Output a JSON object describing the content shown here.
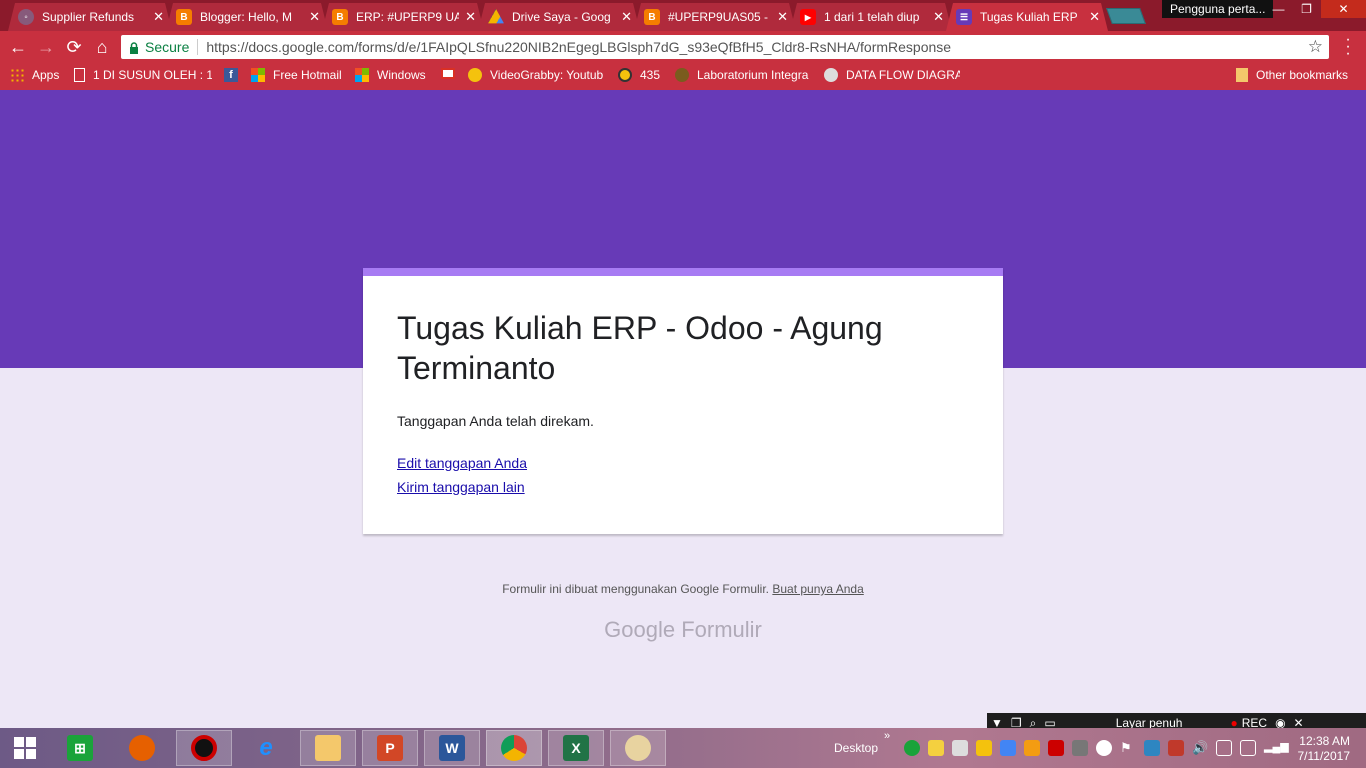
{
  "browser": {
    "tabs": [
      {
        "label": "Supplier Refunds",
        "icon": "odoo-icon",
        "color": "#875a7b"
      },
      {
        "label": "Blogger: Hello, M",
        "icon": "blogger-icon",
        "color": "#f57d00"
      },
      {
        "label": "ERP: #UPERP9 UA",
        "icon": "blogger-icon",
        "color": "#f57d00"
      },
      {
        "label": "Drive Saya - Goog",
        "icon": "drive-icon",
        "color": "#0f9d58"
      },
      {
        "label": "#UPERP9UAS05 -",
        "icon": "blogger-icon",
        "color": "#f57d00"
      },
      {
        "label": "1 dari 1 telah diup",
        "icon": "youtube-icon",
        "color": "#ff0000"
      },
      {
        "label": "Tugas Kuliah ERP",
        "icon": "forms-icon",
        "color": "#673ab7"
      }
    ],
    "profile_label": "Pengguna perta...",
    "address": {
      "secure_label": "Secure",
      "url": "https://docs.google.com/forms/d/e/1FAIpQLSfnu220NIB2nEgegLBGlsph7dG_s93eQfBfH5_Cldr8-RsNHA/formResponse"
    },
    "bookmarks": [
      {
        "label": "Apps",
        "icon": "apps-icon"
      },
      {
        "label": "1 DI SUSUN OLEH : 1",
        "icon": "page-icon"
      },
      {
        "label": "",
        "icon": "facebook-icon"
      },
      {
        "label": "Free Hotmail",
        "icon": "windows-logo-icon"
      },
      {
        "label": "Windows",
        "icon": "windows-logo-icon"
      },
      {
        "label": "",
        "icon": "gmail-icon"
      },
      {
        "label": "VideoGrabby: Youtub",
        "icon": "videograbby-icon"
      },
      {
        "label": "435",
        "icon": "seal-icon"
      },
      {
        "label": "Laboratorium Integra",
        "icon": "seal-icon"
      },
      {
        "label": "DATA FLOW DIAGRA",
        "icon": "diagram-icon"
      }
    ],
    "other_bookmarks": "Other bookmarks"
  },
  "form": {
    "title": "Tugas Kuliah ERP - Odoo - Agung Terminanto",
    "message": "Tanggapan Anda telah direkam.",
    "edit_link": "Edit tanggapan Anda",
    "another_link": "Kirim tanggapan lain",
    "footer_text": "Formulir ini dibuat menggunakan Google Formulir.",
    "footer_link": "Buat punya Anda",
    "logo_word1": "Google",
    "logo_word2": "Formulir"
  },
  "recorder": {
    "mode_label": "Layar penuh",
    "rec_label": "REC"
  },
  "taskbar": {
    "desktop_label": "Desktop",
    "time": "12:38 AM",
    "date": "7/11/2017"
  },
  "colors": {
    "hero": "#673ab7",
    "card_accent": "#a77bf3",
    "page_bg": "#ede7f6",
    "chrome_frame": "#c8303f"
  }
}
